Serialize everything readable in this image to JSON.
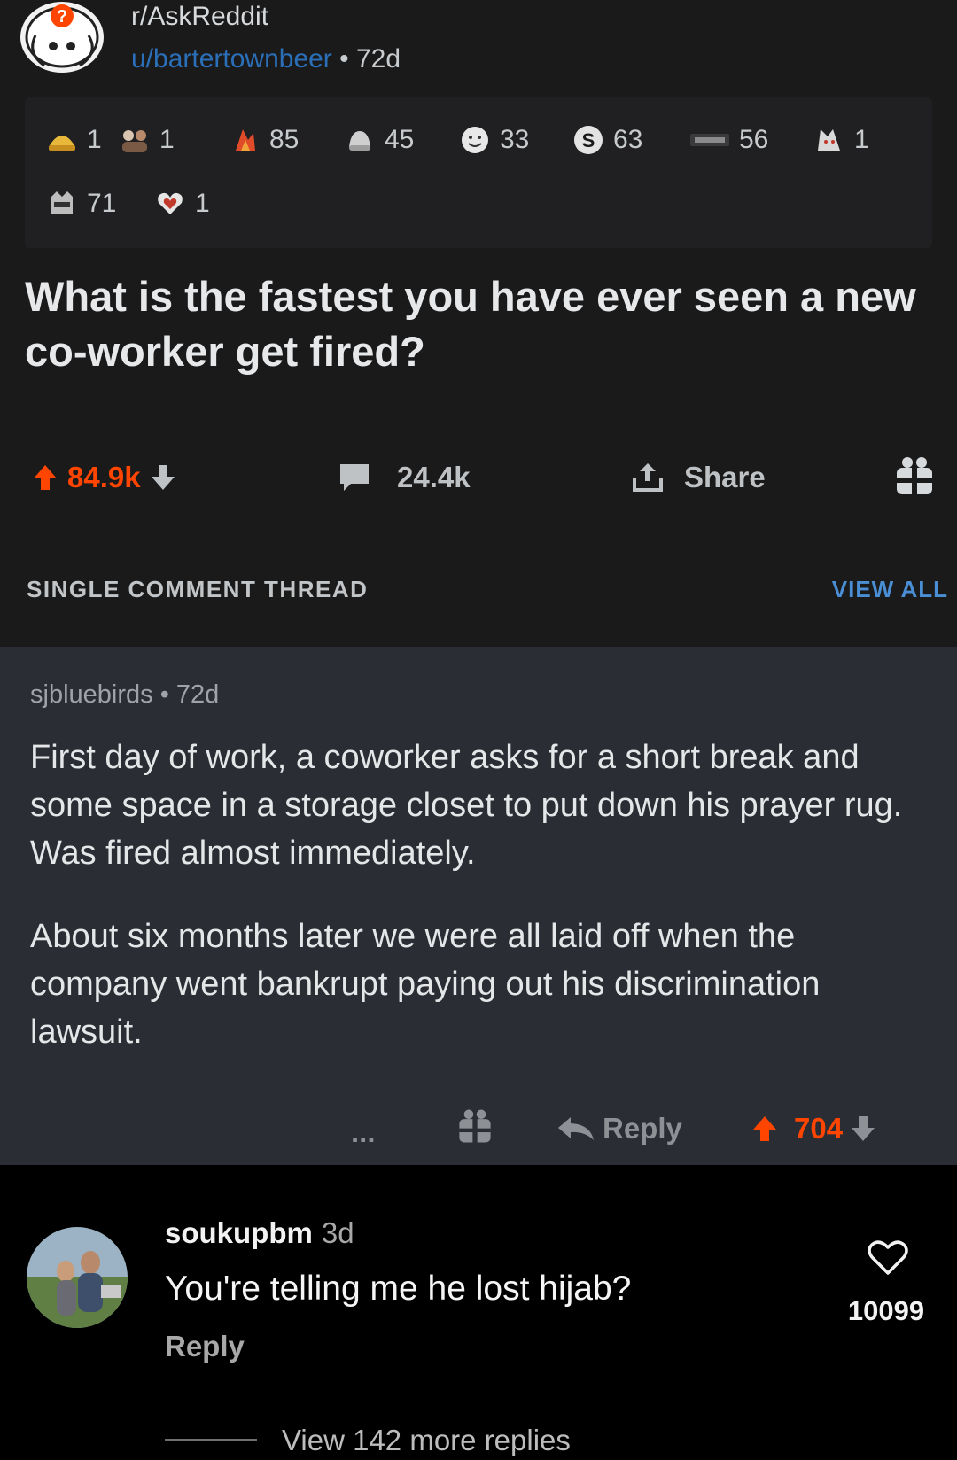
{
  "post": {
    "subreddit": "r/AskReddit",
    "author": "u/bartertownbeer",
    "age": "72d",
    "awards": [
      {
        "icon": "gold-helmet-icon",
        "count": "1"
      },
      {
        "icon": "group-award-icon",
        "count": "1"
      },
      {
        "icon": "fire-award-icon",
        "count": "85"
      },
      {
        "icon": "hands-award-icon",
        "count": "45"
      },
      {
        "icon": "face-award-icon",
        "count": "33"
      },
      {
        "icon": "s-coin-icon",
        "count": "63"
      },
      {
        "icon": "badge-award-icon",
        "count": "56"
      },
      {
        "icon": "cat-award-icon",
        "count": "1"
      },
      {
        "icon": "raccoon-award-icon",
        "count": "71"
      },
      {
        "icon": "heart-hands-icon",
        "count": "1"
      }
    ],
    "title": "What is the fastest you have ever seen a new co-worker get fired?",
    "actions": {
      "upvotes": "84.9k",
      "comments": "24.4k",
      "share": "Share"
    }
  },
  "thread": {
    "label": "SINGLE COMMENT THREAD",
    "view_all": "VIEW ALL"
  },
  "comment": {
    "author": "sjbluebirds",
    "age": "72d",
    "paragraphs": [
      "First day of work, a coworker asks for a short break and some space in a storage closet to put down his prayer rug.  Was fired almost immediately.",
      "About six months later we were all laid off when the company went bankrupt paying out his discrimination lawsuit."
    ],
    "actions": {
      "more": "...",
      "reply": "Reply",
      "votes": "704"
    }
  },
  "ig_comment": {
    "username": "soukupbm",
    "age": "3d",
    "text": "You're telling me he lost hijab?",
    "reply": "Reply",
    "likes": "10099",
    "more_replies": "View 142 more replies"
  },
  "colors": {
    "upvote": "#ff4500",
    "link": "#2b6fb8",
    "view_all": "#4a8fd6",
    "post_bg": "#1a1a1b",
    "comment_bg": "#2b2d35"
  }
}
